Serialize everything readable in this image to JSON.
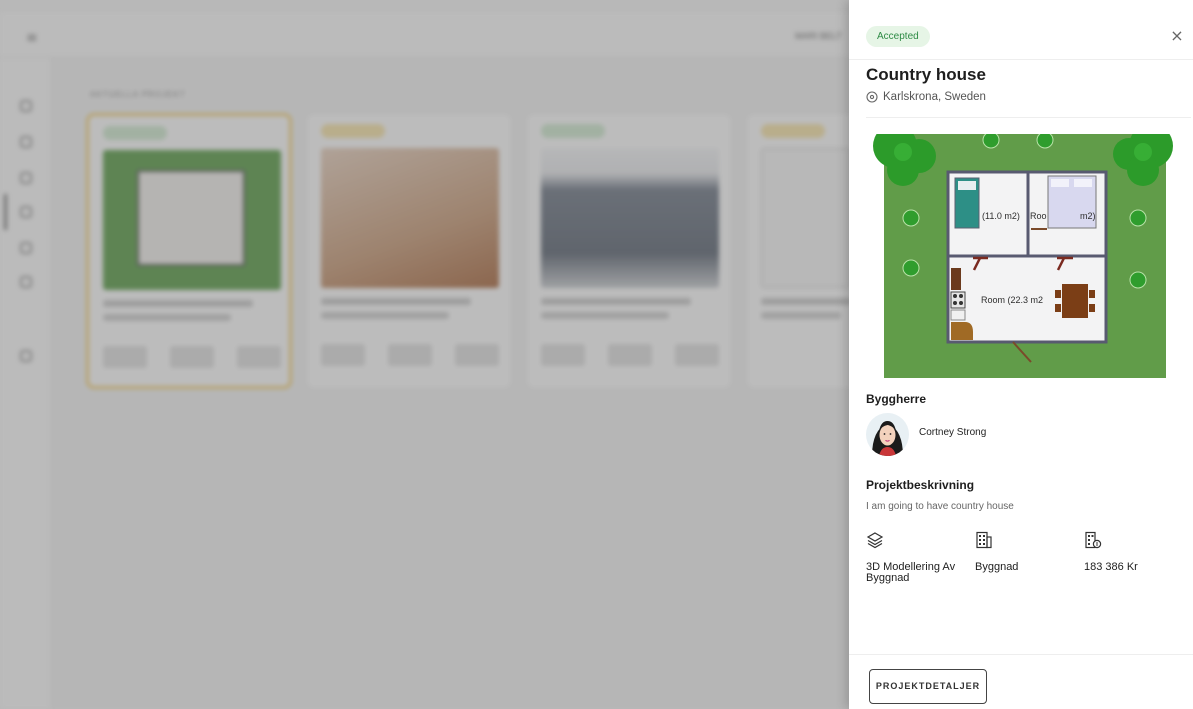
{
  "drawer": {
    "status": "Accepted",
    "close_icon": "×",
    "title": "Country house",
    "location": "Karlskrona, Sweden",
    "floorplan": {
      "room_1": "(11.0 m2)",
      "room_2_left": "Roo",
      "room_2_right": "m2)",
      "room_3": "Room (22.3 m2"
    },
    "client_heading": "Byggherre",
    "client_name": "Cortney Strong",
    "description_heading": "Projektbeskrivning",
    "description": "I am going to have country house",
    "features": [
      {
        "icon": "layers-icon",
        "label": "3D Modellering Av Byggnad"
      },
      {
        "icon": "building-icon",
        "label": "Byggnad"
      },
      {
        "icon": "price-building-icon",
        "label": "183 386 Kr"
      }
    ],
    "details_button": "PROJEKTDETALJER"
  },
  "background": {
    "menu_icon": "≡",
    "heading": "AKTUELLA PROJEKT",
    "top_right": "MARI BELT"
  }
}
